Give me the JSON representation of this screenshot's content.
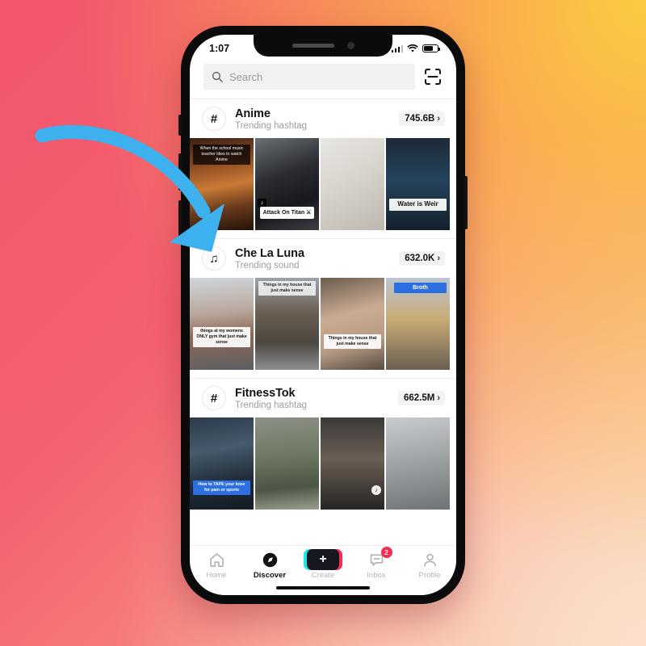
{
  "background": {
    "start_color": "#f2556d",
    "end_color": "#fccb3f"
  },
  "annotation": {
    "arrow_color": "#3db0ee",
    "name": "curved-arrow-pointing-to-trending-sound"
  },
  "phone": {
    "status_bar": {
      "time": "1:07",
      "signal_icon": "cellular-bars-icon",
      "wifi_icon": "wifi-icon",
      "battery_icon": "battery-icon"
    },
    "search": {
      "placeholder": "Search",
      "search_icon": "search-icon",
      "scan_icon": "scan-qr-icon"
    },
    "sections": [
      {
        "id": "anime",
        "icon": "hashtag-icon",
        "icon_glyph": "#",
        "title": "Anime",
        "subtitle": "Trending hashtag",
        "count": "745.6B",
        "chevron": "›",
        "tiles": [
          {
            "name": "tile-anime-1",
            "caption": "When the school music teacher likes to watch Anime",
            "caption_style": "cap-dark",
            "bg": "linear-gradient(170deg,#3a1f14 0%,#8c4a22 28%,#c97b35 52%,#6b3b1c 74%,#241209 100%)"
          },
          {
            "name": "tile-anime-2",
            "caption": "Attack On Titan ⚔",
            "caption_style": "cap-pill",
            "bg": "linear-gradient(160deg,#6b6f75 0%,#2b2d31 40%,#17181b 70%,#3c3e44 100%)",
            "sound_badge": "♪"
          },
          {
            "name": "tile-anime-3",
            "caption": "",
            "caption_style": "",
            "bg": "linear-gradient(150deg,#e8e6e2 0%,#d8d4cd 45%,#bdb7ae 100%)"
          },
          {
            "name": "tile-anime-4",
            "caption": "Water is Weir",
            "caption_style": "cap-white",
            "bg": "linear-gradient(180deg,#1d2a38 0%,#24435c 45%,#14202c 100%)"
          }
        ]
      },
      {
        "id": "che-la-luna",
        "icon": "music-note-icon",
        "icon_glyph": "♫",
        "title": "Che La Luna",
        "subtitle": "Trending sound",
        "count": "632.0K",
        "chevron": "›",
        "tiles": [
          {
            "name": "tile-luna-1",
            "caption": "things at my womens ONLY gym that just make sense",
            "caption_style": "cap-white",
            "bg": "linear-gradient(175deg,#cfd6dc 0%,#b9a79c 38%,#8f6a57 62%,#5c5f63 100%)"
          },
          {
            "name": "tile-luna-2",
            "caption": "Things in my house that just make sense",
            "caption_style": "cap-white",
            "caption_top": true,
            "bg": "linear-gradient(180deg,#9aa3ab 0%,#6f6256 35%,#4b4640 70%,#8c8f93 100%)"
          },
          {
            "name": "tile-luna-3",
            "caption": "Things in my house that just make sense",
            "caption_style": "cap-white",
            "bg": "linear-gradient(165deg,#6b5c4e 0%,#cbab92 40%,#b59a84 70%,#5a4c41 100%)"
          },
          {
            "name": "tile-luna-4",
            "caption": "Broth",
            "caption_style": "cap-blue",
            "caption_top": true,
            "bg": "linear-gradient(180deg,#b9c6d2 0%,#c9ab74 45%,#6a5f52 100%)"
          }
        ]
      },
      {
        "id": "fitnesstok",
        "icon": "hashtag-icon",
        "icon_glyph": "#",
        "title": "FitnessTok",
        "subtitle": "Trending hashtag",
        "count": "662.5M",
        "chevron": "›",
        "tiles": [
          {
            "name": "tile-fitness-1",
            "caption": "How to TAPE your knee for pain or sports",
            "caption_style": "cap-blue",
            "bg": "linear-gradient(170deg,#2c3a4a 0%,#465b6d 35%,#1f2a36 70%,#141c25 100%)"
          },
          {
            "name": "tile-fitness-2",
            "caption": "",
            "caption_style": "",
            "bg": "linear-gradient(175deg,#8c8f86 0%,#6f7a63 40%,#4d5546 75%,#9aa08f 100%)"
          },
          {
            "name": "tile-fitness-3",
            "caption": "",
            "caption_style": "",
            "bg": "linear-gradient(180deg,#3b3a38 0%,#6b5e54 45%,#262524 100%)",
            "logo_badge": "♪"
          },
          {
            "name": "tile-fitness-4",
            "caption": "",
            "caption_style": "",
            "bg": "linear-gradient(170deg,#c9ccce 0%,#9ba0a3 50%,#6e7275 100%)"
          }
        ]
      }
    ],
    "tabs": [
      {
        "name": "tab-home",
        "label": "Home",
        "icon": "home-icon",
        "active": false
      },
      {
        "name": "tab-discover",
        "label": "Discover",
        "icon": "compass-icon",
        "active": true
      },
      {
        "name": "tab-create",
        "label": "Create",
        "icon": "plus-icon",
        "active": false,
        "glyph": "+"
      },
      {
        "name": "tab-inbox",
        "label": "Inbox",
        "icon": "message-icon",
        "active": false,
        "badge": "2"
      },
      {
        "name": "tab-profile",
        "label": "Profile",
        "icon": "person-icon",
        "active": false
      }
    ]
  }
}
